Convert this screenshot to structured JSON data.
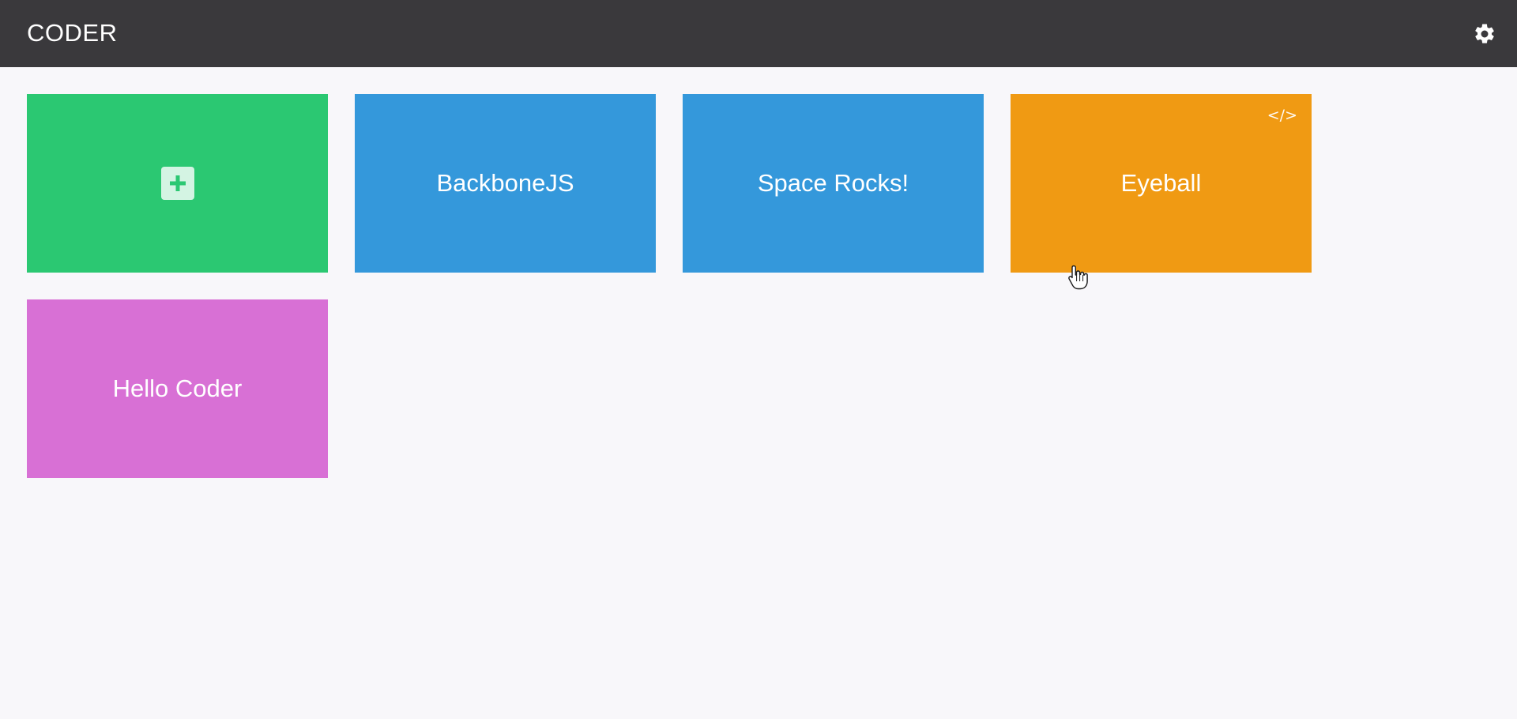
{
  "header": {
    "title": "CODER",
    "settings_icon": "gear-icon"
  },
  "colors": {
    "header_bg": "#3a393c",
    "page_bg": "#f8f7fa",
    "green": "#2bc872",
    "blue": "#3498db",
    "orange": "#f09a13",
    "pink": "#d870d5"
  },
  "tiles": [
    {
      "kind": "add",
      "label": "",
      "icon": "plus-icon",
      "color": "#2bc872"
    },
    {
      "kind": "project",
      "label": "BackboneJS",
      "color": "#3498db"
    },
    {
      "kind": "project",
      "label": "Space Rocks!",
      "color": "#3498db"
    },
    {
      "kind": "project",
      "label": "Eyeball",
      "color": "#f09a13",
      "code_badge": "</>"
    },
    {
      "kind": "project",
      "label": "Hello Coder",
      "color": "#d870d5"
    }
  ]
}
